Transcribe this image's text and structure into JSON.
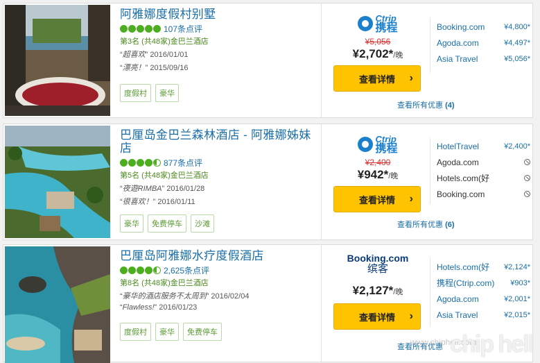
{
  "hotels": [
    {
      "name": "阿雅娜度假村别墅",
      "reviews": "107条点评",
      "rank": "第3名 (共48家)金巴兰酒店",
      "quotes": [
        {
          "text": "超喜欢",
          "date": "2016/01/01"
        },
        {
          "text": "漂亮！",
          "date": "2015/09/16"
        }
      ],
      "tags": [
        "度假村",
        "豪华"
      ],
      "offer_old": "¥5,056",
      "offer_price": "¥2,702*",
      "offer_unit": "/晚",
      "view_label": "查看详情",
      "all_deals": "查看所有优惠",
      "all_deals_count": "(4)",
      "providers": [
        {
          "name": "Booking.com",
          "price": "¥4,800*"
        },
        {
          "name": "Agoda.com",
          "price": "¥4,497*"
        },
        {
          "name": "Asia Travel",
          "price": "¥5,056*"
        }
      ]
    },
    {
      "name": "巴厘岛金巴兰森林酒店 - 阿雅娜姊妹店",
      "reviews": "877条点评",
      "rank": "第5名 (共48家)金巴兰酒店",
      "quotes": [
        {
          "text": "夜遊RIMBA",
          "date": "2016/01/28"
        },
        {
          "text": "很喜欢！",
          "date": "2016/01/11"
        }
      ],
      "tags": [
        "豪华",
        "免费停车",
        "沙滩"
      ],
      "offer_old": "¥2,400",
      "offer_price": "¥942*",
      "offer_unit": "/晚",
      "view_label": "查看详情",
      "all_deals": "查看所有优惠",
      "all_deals_count": "(6)",
      "providers": [
        {
          "name": "HotelTravel",
          "price": "¥2,400*"
        },
        {
          "name": "Agoda.com",
          "price": ""
        },
        {
          "name": "Hotels.com(好",
          "price": ""
        },
        {
          "name": "Booking.com",
          "price": ""
        }
      ]
    },
    {
      "name": "巴厘岛阿雅娜水疗度假酒店",
      "reviews": "2,625条点评",
      "rank": "第8名 (共48家)金巴兰酒店",
      "quotes": [
        {
          "text": "豪华的酒店服务不太周到",
          "date": "2016/02/04"
        },
        {
          "text": "Flawless!",
          "date": "2016/01/23"
        }
      ],
      "tags": [
        "度假村",
        "豪华",
        "免费停车"
      ],
      "offer_old": "",
      "offer_price": "¥2,127*",
      "offer_unit": "/晚",
      "view_label": "查看详情",
      "all_deals": "查看所有优惠",
      "all_deals_count": "",
      "providers": [
        {
          "name": "Hotels.com(好",
          "price": "¥2,124*"
        },
        {
          "name": "携程(Ctrip.com)",
          "price": "¥903*"
        },
        {
          "name": "Agoda.com",
          "price": "¥2,001*"
        },
        {
          "name": "Asia Travel",
          "price": "¥2,015*"
        }
      ]
    }
  ],
  "logos": {
    "ctrip_en": "Ctrip",
    "ctrip_cn": "携程",
    "booking_en": "Booking.com",
    "booking_cn": "缤客"
  },
  "watermark": {
    "site": "www.chiphell.com",
    "brand": "chip hell"
  },
  "colors": {
    "link": "#1a6ea8",
    "button": "#ffc300",
    "bubble": "#4caf1f",
    "strike_price": "#dd3333"
  }
}
